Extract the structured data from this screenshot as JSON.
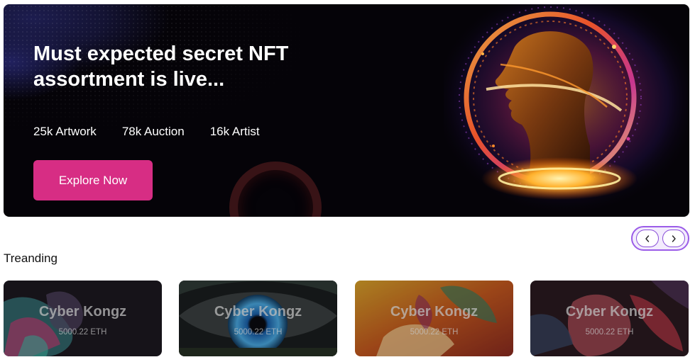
{
  "hero": {
    "title": "Must expected secret NFT assortment is live...",
    "stats": [
      "25k Artwork",
      "78k Auction",
      "16k Artist"
    ],
    "cta_label": "Explore Now",
    "cta_color": "#d72d84",
    "background_color": "#050308"
  },
  "carousel": {
    "prev_icon": "chevron-left-icon",
    "next_icon": "chevron-right-icon",
    "accent_color": "#9b5ce8"
  },
  "trending": {
    "heading": "Treanding",
    "cards": [
      {
        "title": "Cyber Kongz",
        "price": "5000.22 ETH",
        "theme": "pink-teal-figure"
      },
      {
        "title": "Cyber Kongz",
        "price": "5000.22 ETH",
        "theme": "blue-eye"
      },
      {
        "title": "Cyber Kongz",
        "price": "5000.22 ETH",
        "theme": "orange-floral"
      },
      {
        "title": "Cyber Kongz",
        "price": "5000.22 ETH",
        "theme": "red-feather-portrait"
      }
    ]
  }
}
